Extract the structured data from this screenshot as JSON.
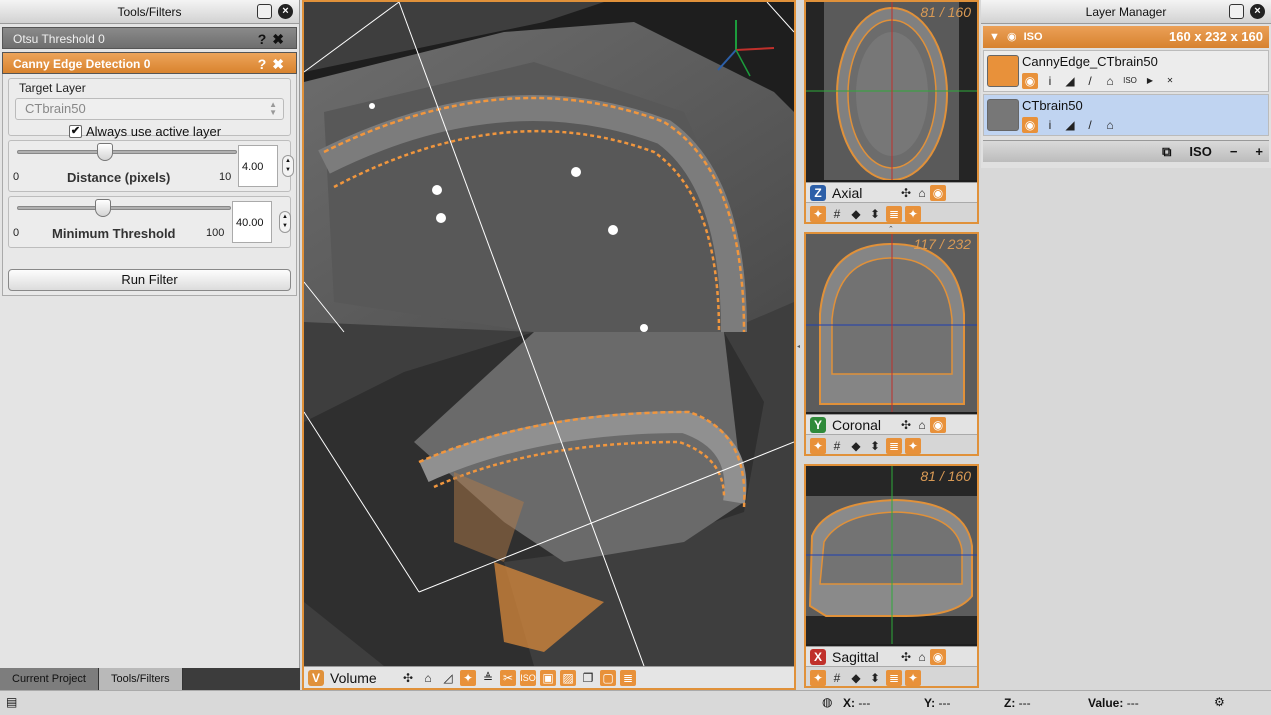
{
  "tools_panel": {
    "title": "Tools/Filters",
    "collapsed_tool": {
      "title": "Otsu Threshold 0",
      "help": "?",
      "close": "✖"
    },
    "active_tool": {
      "title": "Canny Edge Detection 0",
      "help": "?",
      "close": "✖",
      "target_layer_label": "Target Layer",
      "target_layer_value": "CTbrain50",
      "always_use_active_label": "Always use active layer",
      "always_use_active_checked": true,
      "distance": {
        "label": "Distance (pixels)",
        "min": "0",
        "max": "10",
        "value": "4.00",
        "fraction": 0.4
      },
      "threshold": {
        "label": "Minimum Threshold",
        "min": "0",
        "max": "100",
        "value": "40.00",
        "fraction": 0.4
      },
      "run_label": "Run Filter"
    },
    "bottom_tabs": [
      "Current Project",
      "Tools/Filters"
    ]
  },
  "volume_view": {
    "badge": "V",
    "badge_color": "#e0913a",
    "name": "Volume"
  },
  "slice_views": [
    {
      "badge": "Z",
      "badge_color": "#2c5fa8",
      "name": "Axial",
      "counter": "81 / 160"
    },
    {
      "badge": "Y",
      "badge_color": "#2f8a3a",
      "name": "Coronal",
      "counter": "117 / 232"
    },
    {
      "badge": "X",
      "badge_color": "#c0302b",
      "name": "Sagittal",
      "counter": "81 / 160"
    }
  ],
  "layer_manager": {
    "title": "Layer Manager",
    "group_label": "ISO",
    "dimensions": "160 x 232 x 160",
    "layers": [
      {
        "name": "CannyEdge_CTbrain50",
        "selected": false
      },
      {
        "name": "CTbrain50",
        "selected": true
      }
    ],
    "bottom_iso": "ISO",
    "bottom_minus": "−",
    "bottom_plus": "+"
  },
  "status_bar": {
    "x_label": "X:",
    "x_value": "---",
    "y_label": "Y:",
    "y_value": "---",
    "z_label": "Z:",
    "z_value": "---",
    "value_label": "Value:",
    "value_value": "---"
  },
  "colors": {
    "accent": "#e0913a",
    "edge": "#f0963e"
  }
}
